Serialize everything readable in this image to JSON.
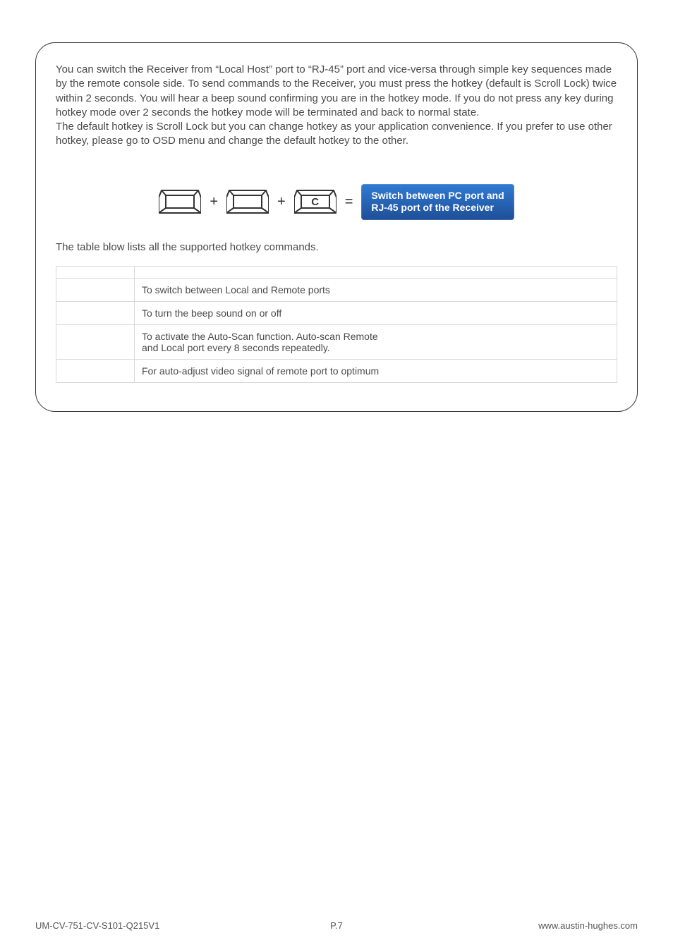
{
  "intro": {
    "p1": "You can switch the Receiver from “Local Host” port to “RJ-45” port and vice-versa through simple key sequences made by the remote console side. To send commands to the Receiver, you must press the hotkey (default is Scroll Lock) twice within 2 seconds. You will hear a beep sound confirming you are in the hotkey mode. If you do not press any key during hotkey mode over 2 seconds the hotkey mode will be terminated and back to normal state.",
    "p2": "The default hotkey is Scroll Lock but you can change hotkey as your application convenience. If you prefer to use other hotkey, please go to OSD menu and change the default hotkey to the other."
  },
  "figure": {
    "plus": "+",
    "equals": "=",
    "key_c_label": "C",
    "result_line1": "Switch between PC port and",
    "result_line2": "RJ-45 port of the Receiver"
  },
  "table_intro": "The table blow lists all the supported hotkey commands.",
  "table": {
    "header_key": "",
    "header_desc": "",
    "rows": [
      {
        "key": "",
        "desc": "To switch between Local and Remote ports"
      },
      {
        "key": "",
        "desc": "To turn the beep sound on or off"
      },
      {
        "key": "",
        "desc": "To activate the Auto-Scan function. Auto-scan Remote\nand Local port every 8 seconds repeatedly."
      },
      {
        "key": "",
        "desc": "For auto-adjust video signal of remote port to optimum"
      }
    ]
  },
  "footer": {
    "left": "UM-CV-751-CV-S101-Q215V1",
    "center": "P.7",
    "right": "www.austin-hughes.com"
  }
}
